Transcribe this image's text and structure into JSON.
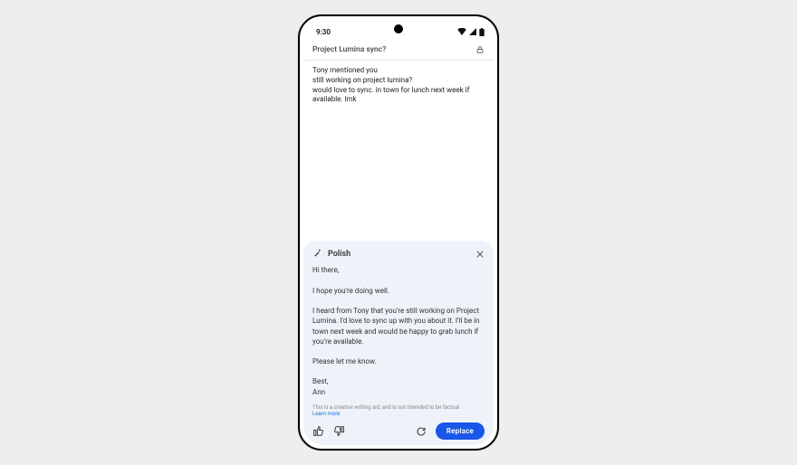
{
  "status": {
    "time": "9:30"
  },
  "subject": "Project Lumina sync?",
  "compose_body": "Tony mentioned you\nstill working on project lumina?\nwould love to sync. in town for lunch next week if available. lmk",
  "polish": {
    "title": "Polish",
    "text": "Hi there,\n\nI hope you're doing well.\n\nI heard from Tony that you're still working on Project Lumina. I'd love to sync up with you about it. I'll be in town next week and would be happy to grab lunch if you're available.\n\nPlease let me know.\n\nBest,\nAnn",
    "disclaimer": "This is a creative writing aid, and is not intended to be factual",
    "learn_more": "Learn more",
    "replace": "Replace"
  }
}
